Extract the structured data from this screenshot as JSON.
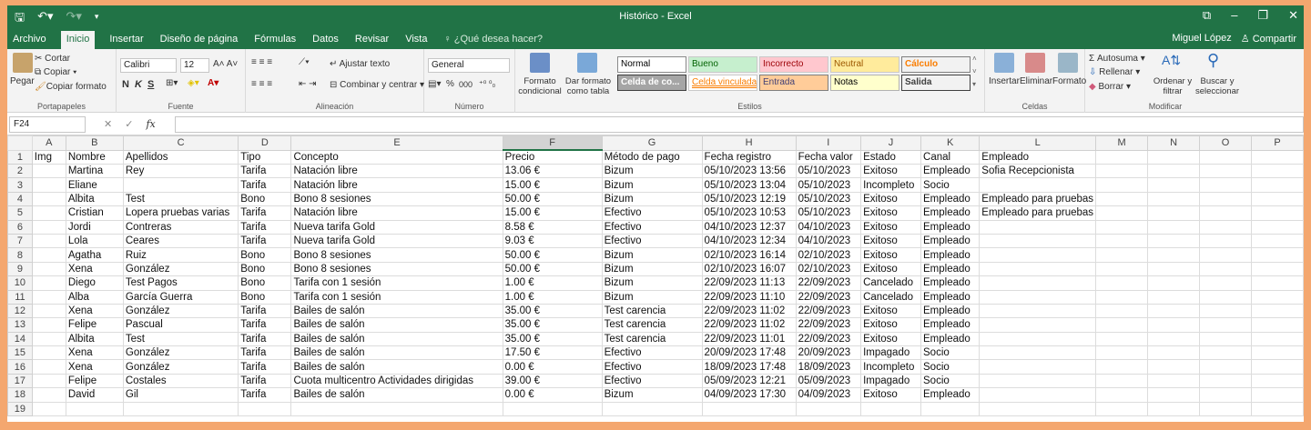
{
  "window": {
    "title": "Histórico - Excel",
    "user": "Miguel López",
    "share": "Compartir"
  },
  "tabs": [
    "Archivo",
    "Inicio",
    "Insertar",
    "Diseño de página",
    "Fórmulas",
    "Datos",
    "Revisar",
    "Vista"
  ],
  "active_tab": "Inicio",
  "tell_me": "¿Qué desea hacer?",
  "ribbon": {
    "clipboard": {
      "paste": "Pegar",
      "cut": "Cortar",
      "copy": "Copiar",
      "format_painter": "Copiar formato",
      "label": "Portapapeles"
    },
    "font": {
      "name": "Calibri",
      "size": "12",
      "bold": "N",
      "italic": "K",
      "underline": "S",
      "label": "Fuente"
    },
    "alignment": {
      "wrap": "Ajustar texto",
      "merge": "Combinar y centrar",
      "label": "Alineación"
    },
    "number": {
      "format": "General",
      "percent": "%",
      "thousands": "000",
      "label": "Número"
    },
    "styles": {
      "conditional": "Formato condicional",
      "as_table": "Dar formato como tabla",
      "label": "Estilos",
      "cells": [
        {
          "text": "Normal",
          "bg": "#ffffff",
          "fg": "#000000",
          "border": "#8a8a8a"
        },
        {
          "text": "Bueno",
          "bg": "#c6efce",
          "fg": "#006100",
          "border": "#c9c9c9"
        },
        {
          "text": "Incorrecto",
          "bg": "#ffc7ce",
          "fg": "#9c0006",
          "border": "#c9c9c9"
        },
        {
          "text": "Neutral",
          "bg": "#ffeb9c",
          "fg": "#9c5700",
          "border": "#c9c9c9"
        },
        {
          "text": "Cálculo",
          "bg": "#f2f2f2",
          "fg": "#fa7d00",
          "border": "#7f7f7f"
        },
        {
          "text": "Celda de co...",
          "bg": "#a5a5a5",
          "fg": "#ffffff",
          "border": "#3f3f3f"
        },
        {
          "text": "Celda vinculada",
          "bg": "#ffffff",
          "fg": "#fa7d00",
          "border": "#c9c9c9"
        },
        {
          "text": "Entrada",
          "bg": "#ffcc99",
          "fg": "#3f3f76",
          "border": "#7f7f7f"
        },
        {
          "text": "Notas",
          "bg": "#ffffcc",
          "fg": "#000000",
          "border": "#b2b2b2"
        },
        {
          "text": "Salida",
          "bg": "#f2f2f2",
          "fg": "#3f3f3f",
          "border": "#3f3f3f"
        }
      ]
    },
    "cells": {
      "insert": "Insertar",
      "delete": "Eliminar",
      "format": "Formato",
      "label": "Celdas"
    },
    "editing": {
      "autosum": "Autosuma",
      "fill": "Rellenar",
      "clear": "Borrar",
      "sort": "Ordenar y filtrar",
      "find": "Buscar y seleccionar",
      "label": "Modificar"
    }
  },
  "formula_bar": {
    "name_box": "F24",
    "fx": "fx",
    "value": ""
  },
  "sheet": {
    "columns": [
      "A",
      "B",
      "C",
      "D",
      "E",
      "F",
      "G",
      "H",
      "I",
      "J",
      "K",
      "L",
      "M",
      "N",
      "O",
      "P"
    ],
    "selected_column": "F",
    "rows": [
      [
        "Img",
        "Nombre",
        "Apellidos",
        "Tipo",
        "Concepto",
        "Precio",
        "Método de pago",
        "Fecha registro",
        "Fecha valor",
        "Estado",
        "Canal",
        "Empleado",
        "",
        "",
        "",
        ""
      ],
      [
        "",
        "Martina",
        "Rey",
        "Tarifa",
        "Natación libre",
        "13.06 €",
        "Bizum",
        "05/10/2023 13:56",
        "05/10/2023",
        "Exitoso",
        "Empleado",
        "Sofia Recepcionista",
        "",
        "",
        "",
        ""
      ],
      [
        "",
        "Eliane",
        "",
        "Tarifa",
        "Natación libre",
        "15.00 €",
        "Bizum",
        "05/10/2023 13:04",
        "05/10/2023",
        "Incompleto",
        "Socio",
        "",
        "",
        "",
        "",
        ""
      ],
      [
        "",
        "Albita",
        "Test",
        "Bono",
        "Bono 8 sesiones",
        "50.00 €",
        "Bizum",
        "05/10/2023 12:19",
        "05/10/2023",
        "Exitoso",
        "Empleado",
        "Empleado para pruebas",
        "",
        "",
        "",
        ""
      ],
      [
        "",
        "Cristian",
        "Lopera pruebas varias",
        "Tarifa",
        "Natación libre",
        "15.00 €",
        "Efectivo",
        "05/10/2023 10:53",
        "05/10/2023",
        "Exitoso",
        "Empleado",
        "Empleado para pruebas",
        "",
        "",
        "",
        ""
      ],
      [
        "",
        "Jordi",
        "Contreras",
        "Tarifa",
        "Nueva tarifa Gold",
        "8.58 €",
        "Efectivo",
        "04/10/2023 12:37",
        "04/10/2023",
        "Exitoso",
        "Empleado",
        "",
        "",
        "",
        "",
        ""
      ],
      [
        "",
        "Lola",
        "Ceares",
        "Tarifa",
        "Nueva tarifa Gold",
        "9.03 €",
        "Efectivo",
        "04/10/2023 12:34",
        "04/10/2023",
        "Exitoso",
        "Empleado",
        "",
        "",
        "",
        "",
        ""
      ],
      [
        "",
        "Agatha",
        "Ruiz",
        "Bono",
        "Bono 8 sesiones",
        "50.00 €",
        "Bizum",
        "02/10/2023 16:14",
        "02/10/2023",
        "Exitoso",
        "Empleado",
        "",
        "",
        "",
        "",
        ""
      ],
      [
        "",
        "Xena",
        "González",
        "Bono",
        "Bono 8 sesiones",
        "50.00 €",
        "Bizum",
        "02/10/2023 16:07",
        "02/10/2023",
        "Exitoso",
        "Empleado",
        "",
        "",
        "",
        "",
        ""
      ],
      [
        "",
        "Diego",
        "Test Pagos",
        "Bono",
        "Tarifa con 1 sesión",
        "1.00 €",
        "Bizum",
        "22/09/2023 11:13",
        "22/09/2023",
        "Cancelado",
        "Empleado",
        "",
        "",
        "",
        "",
        ""
      ],
      [
        "",
        "Alba",
        "García Guerra",
        "Bono",
        "Tarifa con 1 sesión",
        "1.00 €",
        "Bizum",
        "22/09/2023 11:10",
        "22/09/2023",
        "Cancelado",
        "Empleado",
        "",
        "",
        "",
        "",
        ""
      ],
      [
        "",
        "Xena",
        "González",
        "Tarifa",
        "Bailes de salón",
        "35.00 €",
        "Test carencia",
        "22/09/2023 11:02",
        "22/09/2023",
        "Exitoso",
        "Empleado",
        "",
        "",
        "",
        "",
        ""
      ],
      [
        "",
        "Felipe",
        "Pascual",
        "Tarifa",
        "Bailes de salón",
        "35.00 €",
        "Test carencia",
        "22/09/2023 11:02",
        "22/09/2023",
        "Exitoso",
        "Empleado",
        "",
        "",
        "",
        "",
        ""
      ],
      [
        "",
        "Albita",
        "Test",
        "Tarifa",
        "Bailes de salón",
        "35.00 €",
        "Test carencia",
        "22/09/2023 11:01",
        "22/09/2023",
        "Exitoso",
        "Empleado",
        "",
        "",
        "",
        "",
        ""
      ],
      [
        "",
        "Xena",
        "González",
        "Tarifa",
        "Bailes de salón",
        "17.50 €",
        "Efectivo",
        "20/09/2023 17:48",
        "20/09/2023",
        "Impagado",
        "Socio",
        "",
        "",
        "",
        "",
        ""
      ],
      [
        "",
        "Xena",
        "González",
        "Tarifa",
        "Bailes de salón",
        "0.00 €",
        "Efectivo",
        "18/09/2023 17:48",
        "18/09/2023",
        "Incompleto",
        "Socio",
        "",
        "",
        "",
        "",
        ""
      ],
      [
        "",
        "Felipe",
        "Costales",
        "Tarifa",
        "Cuota multicentro Actividades dirigidas",
        "39.00 €",
        "Efectivo",
        "05/09/2023 12:21",
        "05/09/2023",
        "Impagado",
        "Socio",
        "",
        "",
        "",
        "",
        ""
      ],
      [
        "",
        "David",
        "Gil",
        "Tarifa",
        "Bailes de salón",
        "0.00 €",
        "Bizum",
        "04/09/2023 17:30",
        "04/09/2023",
        "Exitoso",
        "Empleado",
        "",
        "",
        "",
        "",
        ""
      ],
      [
        "",
        "",
        "",
        "",
        "",
        "",
        "",
        "",
        "",
        "",
        "",
        "",
        "",
        "",
        "",
        ""
      ]
    ]
  },
  "colors": {
    "excel_green": "#217346",
    "background": "#f4a76f"
  }
}
